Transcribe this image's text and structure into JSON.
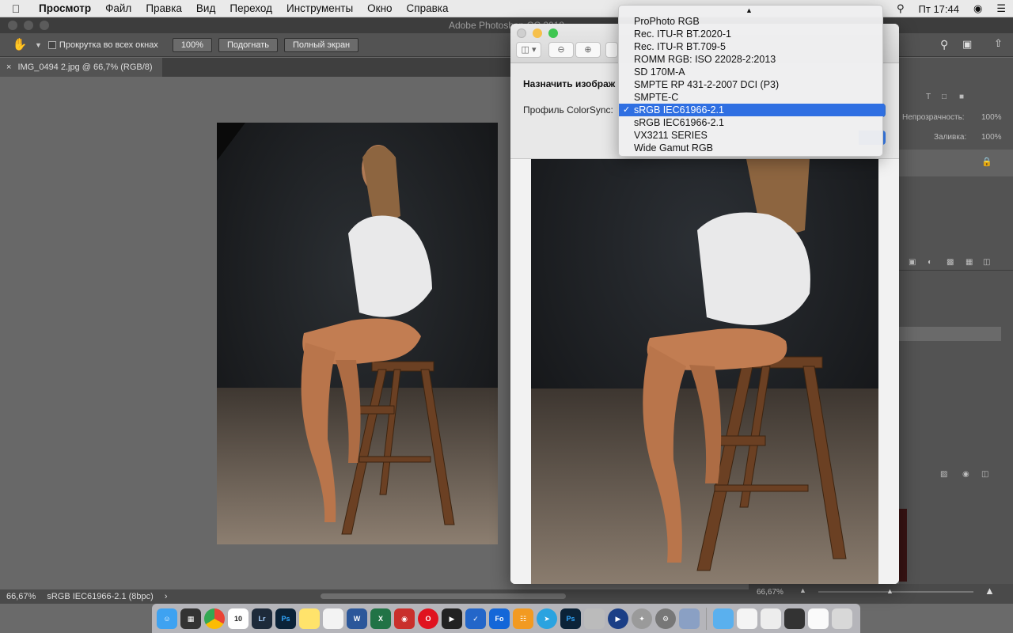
{
  "menubar": {
    "app_name": "Просмотр",
    "items": [
      "Файл",
      "Правка",
      "Вид",
      "Переход",
      "Инструменты",
      "Окно",
      "Справка"
    ],
    "clock": "Пт 17:44"
  },
  "photoshop": {
    "window_title": "Adobe Photoshop CC 2018",
    "options": {
      "scroll_all_windows": "Прокрутка во всех окнах",
      "zoom_100": "100%",
      "fit": "Подогнать",
      "fullscreen": "Полный экран"
    },
    "document_tab": "IMG_0494 2.jpg @ 66,7% (RGB/8)",
    "status": {
      "zoom": "66,67%",
      "profile": "sRGB IEC61966-2.1 (8bpc)"
    },
    "right_panel": {
      "opacity_label": "Непрозрачность:",
      "opacity_value": "100%",
      "fill_label": "Заливка:",
      "fill_value": "100%",
      "nav_zoom": "66,67%"
    }
  },
  "preview": {
    "sheet_title": "Назначить изображ",
    "colorsync_label": "Профиль ColorSync:",
    "dropdown": {
      "options": [
        "ProPhoto RGB",
        "Rec. ITU-R BT.2020-1",
        "Rec. ITU-R BT.709-5",
        "ROMM RGB: ISO 22028-2:2013",
        "SD 170M-A",
        "SMPTE RP 431-2-2007 DCI (P3)",
        "SMPTE-C",
        "sRGB IEC61966-2.1",
        "sRGB IEC61966-2.1",
        "VX3211 SERIES",
        "Wide Gamut RGB"
      ],
      "selected_index": 7
    }
  },
  "dock": {
    "calendar_day": "10",
    "items": [
      "Finder",
      "Mission Control",
      "Chrome",
      "Calendar",
      "Lightroom",
      "Photoshop",
      "Notes",
      "TextEdit",
      "Word",
      "Excel",
      "Screen Recorder",
      "Opera",
      "Final Cut",
      "Tasks",
      "Fotor",
      "Books",
      "Telegram",
      "Photoshop",
      "Preview",
      "QuickTime",
      "Launchpad",
      "System Preferences",
      "Photos",
      "Folder",
      "Document",
      "Document",
      "Document",
      "Document",
      "Trash"
    ]
  }
}
